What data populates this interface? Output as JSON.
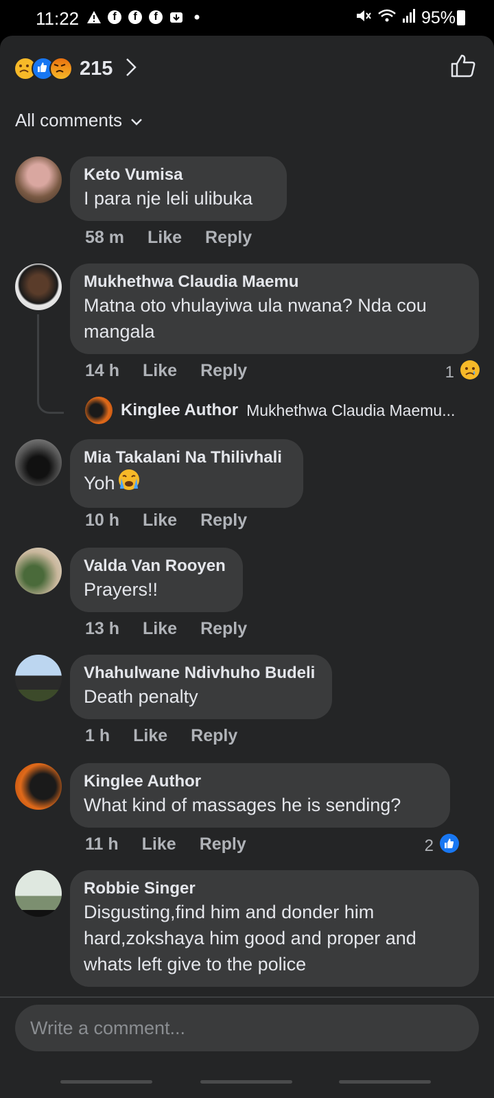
{
  "status": {
    "time": "11:22",
    "battery": "95%"
  },
  "header": {
    "reaction_count": "215",
    "filter_label": "All comments"
  },
  "comments": [
    {
      "author": "Keto Vumisa",
      "text": "I para nje leli ulibuka",
      "time": "58 m",
      "like": "Like",
      "reply": "Reply"
    },
    {
      "author": "Mukhethwa Claudia Maemu",
      "text": "Matna oto vhulayiwa ula nwana? Nda cou mangala",
      "time": "14 h",
      "like": "Like",
      "reply": "Reply",
      "reaction_count": "1",
      "reply_preview": {
        "author": "Kinglee Author",
        "text": "Mukhethwa Claudia Maemu..."
      }
    },
    {
      "author": "Mia Takalani Na Thilivhali",
      "text": "Yoh",
      "time": "10 h",
      "like": "Like",
      "reply": "Reply"
    },
    {
      "author": "Valda Van Rooyen",
      "text": "Prayers!!",
      "time": "13 h",
      "like": "Like",
      "reply": "Reply"
    },
    {
      "author": "Vhahulwane Ndivhuho Budeli",
      "text": "Death penalty",
      "time": "1 h",
      "like": "Like",
      "reply": "Reply"
    },
    {
      "author": "Kinglee Author",
      "text": "What kind of massages he is sending?",
      "time": "11 h",
      "like": "Like",
      "reply": "Reply",
      "reaction_count": "2"
    },
    {
      "author": "Robbie Singer",
      "text": "Disgusting,find him and donder him hard,zokshaya him good and proper and whats left give to the police"
    }
  ],
  "composer": {
    "placeholder": "Write a comment..."
  },
  "colors": {
    "background": "#242526",
    "bubble": "#3a3b3c",
    "like_blue": "#1877f2"
  }
}
